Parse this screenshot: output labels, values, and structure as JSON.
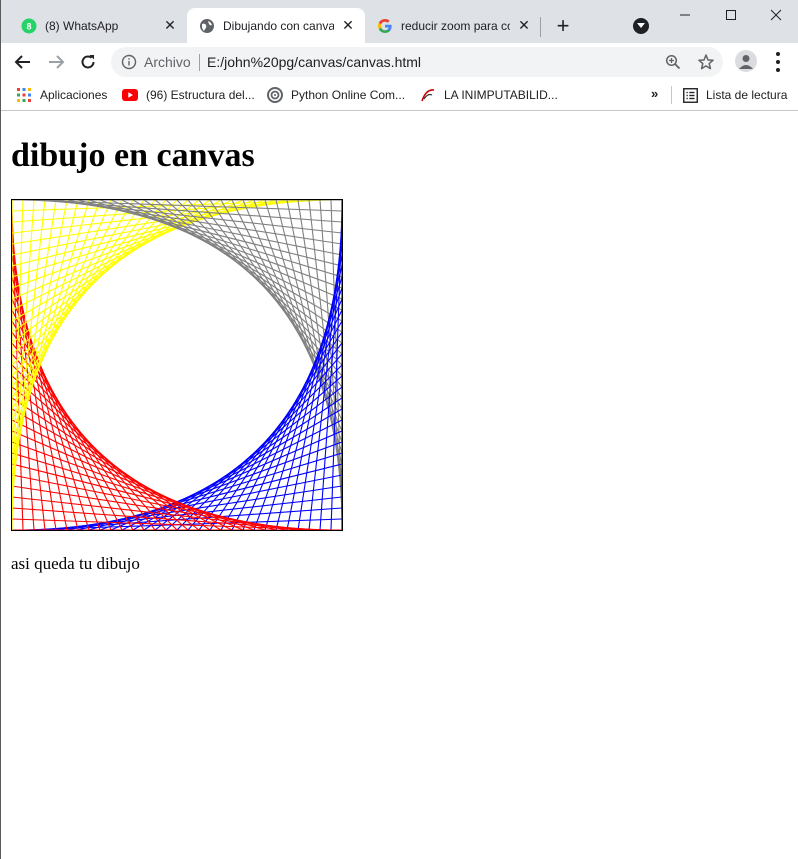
{
  "browser": {
    "tabs": [
      {
        "title": "(8) WhatsApp",
        "icon": "whatsapp-icon",
        "badge": "8",
        "active": false
      },
      {
        "title": "Dibujando con canvas",
        "icon": "globe-icon",
        "active": true
      },
      {
        "title": "reducir zoom para co",
        "icon": "google-icon",
        "active": false
      }
    ],
    "address": {
      "scheme_label": "Archivo",
      "url": "E:/john%20pg/canvas/canvas.html"
    },
    "bookmarks": [
      {
        "label": "Aplicaciones",
        "icon": "apps-grid-icon"
      },
      {
        "label": "(96) Estructura del...",
        "icon": "youtube-icon"
      },
      {
        "label": "Python Online Com...",
        "icon": "python-online-icon"
      },
      {
        "label": "LA INIMPUTABILID...",
        "icon": "bookmark-site-icon"
      }
    ],
    "reading_list_label": "Lista de lectura"
  },
  "page": {
    "heading": "dibujo en canvas",
    "caption": "asi queda tu dibujo",
    "drawing": {
      "lines_per_corner": 30,
      "colors": {
        "top_left": "#ffff00",
        "top_right": "#808080",
        "bottom_right": "#0000ff",
        "bottom_left": "#ff0000"
      }
    }
  },
  "colors": {
    "tabstrip": "#dee1e6",
    "omnibox": "#f1f3f4",
    "text": "#202124"
  }
}
